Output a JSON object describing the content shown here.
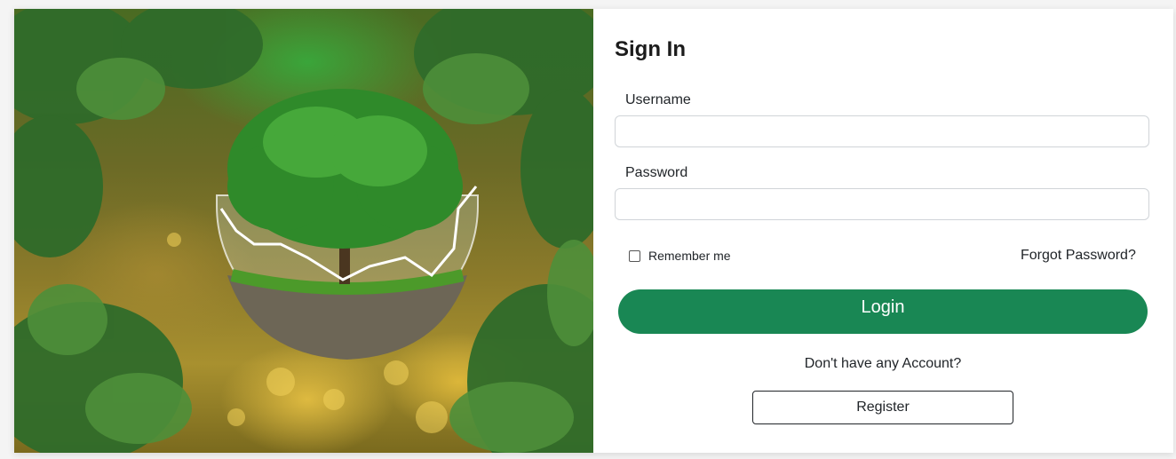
{
  "hero": {
    "image_name": "tree-in-glass-sphere"
  },
  "form": {
    "title": "Sign In",
    "username_label": "Username",
    "username_value": "",
    "password_label": "Password",
    "password_value": "",
    "remember_label": "Remember me",
    "remember_checked": false,
    "forgot_label": "Forgot Password?",
    "login_label": "Login",
    "no_account_text": "Don't have any Account?",
    "register_label": "Register"
  },
  "colors": {
    "primary": "#198754",
    "background": "#f4f4f4"
  }
}
